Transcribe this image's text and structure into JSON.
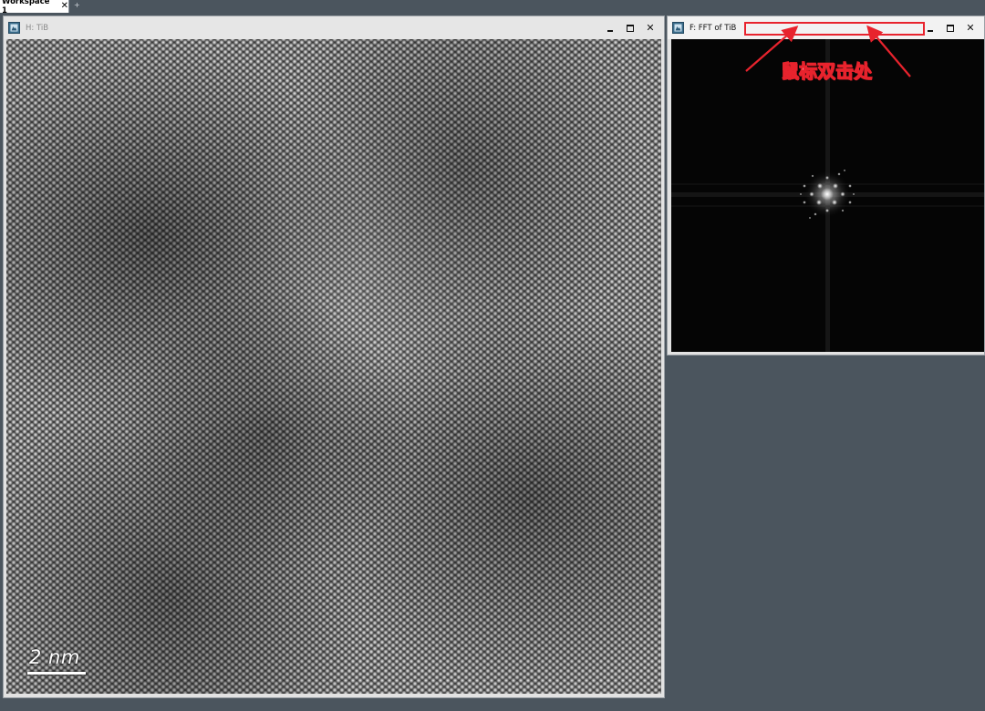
{
  "workspace": {
    "tab_label": "Workspace 1",
    "tab_close_glyph": "✕",
    "add_tab_glyph": "+"
  },
  "windows": {
    "image": {
      "title": "H: TiB",
      "icon": "app-image-icon",
      "scalebar_label": "2 nm",
      "controls": {
        "close_glyph": "✕"
      }
    },
    "fft": {
      "title": "F: FFT of TiB",
      "icon": "app-image-icon",
      "controls": {
        "close_glyph": "✕"
      }
    }
  },
  "annotation": {
    "text": "鼠标双击处",
    "color": "#e8232d"
  },
  "colors": {
    "workspace_background": "#4b555e",
    "window_frame": "#e2e2e2",
    "annotation_red": "#e8232d"
  }
}
